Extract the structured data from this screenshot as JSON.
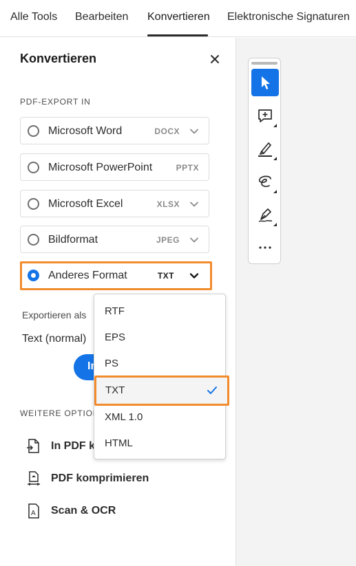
{
  "nav": {
    "tabs": [
      {
        "label": "Alle Tools"
      },
      {
        "label": "Bearbeiten"
      },
      {
        "label": "Konvertieren"
      },
      {
        "label": "Elektronische Signaturen"
      }
    ],
    "active_tab": "Konvertieren"
  },
  "panel": {
    "title": "Konvertieren",
    "export_section_label": "PDF-EXPORT IN",
    "options": [
      {
        "label": "Microsoft Word",
        "format": "DOCX",
        "selected": false
      },
      {
        "label": "Microsoft PowerPoint",
        "format": "PPTX",
        "selected": false
      },
      {
        "label": "Microsoft Excel",
        "format": "XLSX",
        "selected": false
      },
      {
        "label": "Bildformat",
        "format": "JPEG",
        "selected": false
      },
      {
        "label": "Anderes Format",
        "format": "TXT",
        "selected": true
      }
    ],
    "export_as_label": "Exportieren als",
    "export_as_value": "Text (normal)",
    "convert_button_visible": "In",
    "more_section_label": "WEITERE OPTIONEN",
    "more_items": [
      {
        "label": "In PDF ko",
        "icon": "convert-to-pdf-icon"
      },
      {
        "label": "PDF komprimieren",
        "icon": "compress-pdf-icon"
      },
      {
        "label": "Scan & OCR",
        "icon": "scan-ocr-icon"
      }
    ]
  },
  "dropdown": {
    "items": [
      "RTF",
      "EPS",
      "PS",
      "TXT",
      "XML 1.0",
      "HTML"
    ],
    "selected": "TXT"
  },
  "toolbar": {
    "tools": [
      "select-pointer-icon",
      "add-comment-icon",
      "highlight-icon",
      "freehand-draw-icon",
      "signature-pen-icon",
      "more-icon"
    ],
    "active_tool": "select-pointer-icon"
  },
  "colors": {
    "accent": "#1473e6",
    "highlight_outline": "#f28b2c"
  }
}
